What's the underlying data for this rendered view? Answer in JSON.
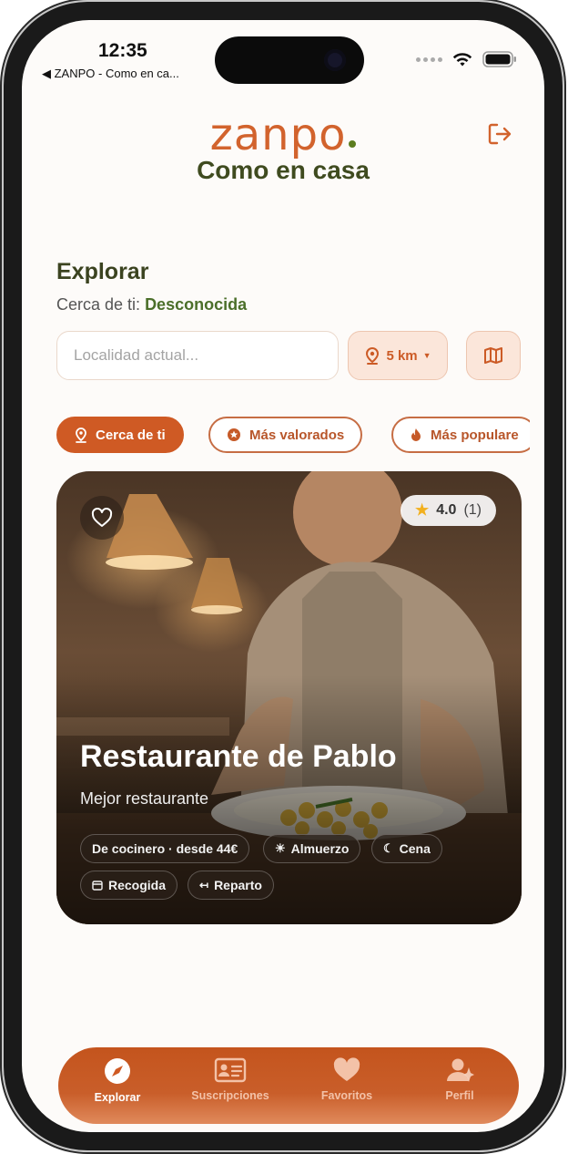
{
  "status_bar": {
    "time": "12:35",
    "back_label": "◀ ZANPO - Como en ca...",
    "icons": [
      "signal-dots-icon",
      "wifi-icon",
      "battery-icon"
    ]
  },
  "brand": {
    "logo_text": "zanpo",
    "tagline": "Como en casa",
    "logo_color": "#d2632d",
    "tagline_color": "#3f4b1f"
  },
  "header": {
    "logout_icon": "logout-icon"
  },
  "explore": {
    "title": "Explorar",
    "near_prefix": "Cerca de ti:",
    "near_value": "Desconocida"
  },
  "search": {
    "placeholder": "Localidad actual...",
    "value": "",
    "distance_label": "5 km",
    "distance_icon": "location-pin-icon",
    "map_icon": "map-icon"
  },
  "filters": [
    {
      "label": "Cerca de ti",
      "icon": "location-pin-icon",
      "active": true
    },
    {
      "label": "Más valorados",
      "icon": "star-badge-icon",
      "active": false
    },
    {
      "label": "Más populare",
      "icon": "fire-icon",
      "active": false
    }
  ],
  "restaurant_card": {
    "name": "Restaurante de Pablo",
    "subtitle": "Mejor restaurante",
    "rating": "4.0",
    "rating_count": "(1)",
    "tags": [
      {
        "label": "De cocinero · desde 44€",
        "icon": ""
      },
      {
        "label": "Almuerzo",
        "icon": "sun-icon"
      },
      {
        "label": "Cena",
        "icon": "moon-icon"
      },
      {
        "label": "Recogida",
        "icon": "bag-icon"
      },
      {
        "label": "Reparto",
        "icon": "delivery-arrows-icon"
      }
    ]
  },
  "bottom_nav": [
    {
      "label": "Explorar",
      "icon": "compass-icon",
      "active": true
    },
    {
      "label": "Suscripciones",
      "icon": "id-card-icon",
      "active": false
    },
    {
      "label": "Favoritos",
      "icon": "heart-icon",
      "active": false
    },
    {
      "label": "Perfil",
      "icon": "user-icon",
      "active": false
    }
  ],
  "colors": {
    "accent": "#cf5a24",
    "accent_soft": "#fbe6da",
    "green": "#4b6f2a"
  }
}
